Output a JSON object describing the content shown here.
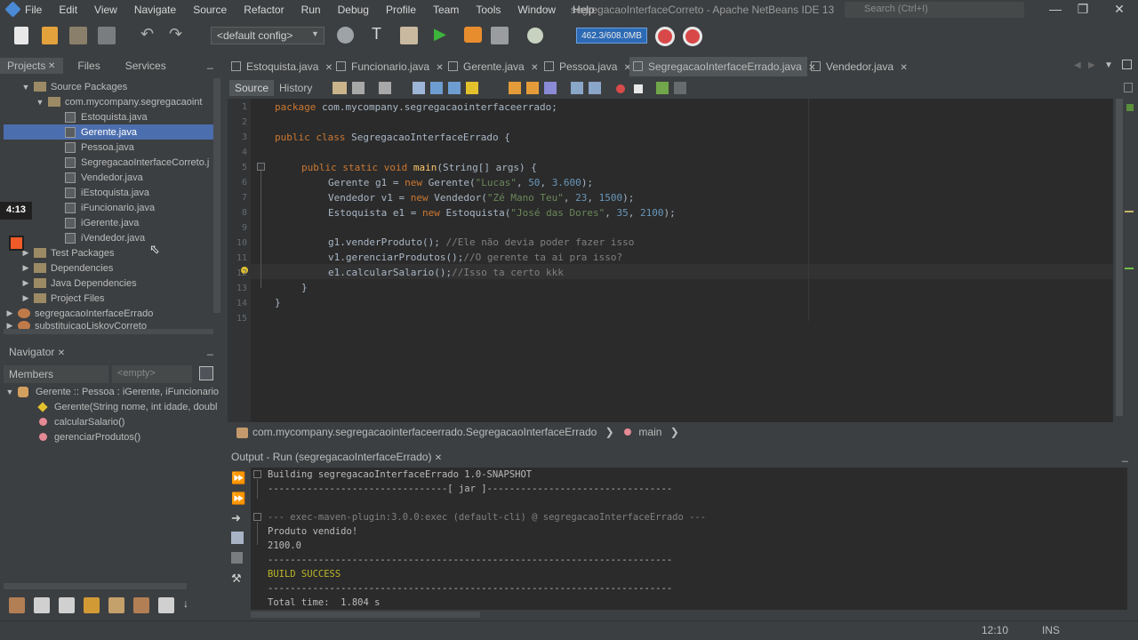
{
  "menu": [
    "File",
    "Edit",
    "View",
    "Navigate",
    "Source",
    "Refactor",
    "Run",
    "Debug",
    "Profile",
    "Team",
    "Tools",
    "Window",
    "Help"
  ],
  "window_title": "segregacaoInterfaceCorreto - Apache NetBeans IDE 13",
  "search_placeholder": "Search (Ctrl+I)",
  "toolbar": {
    "config": "<default config>",
    "memory": "462.3/608.0MB"
  },
  "projects_tabs": [
    "Projects",
    "Files",
    "Services"
  ],
  "tree": [
    {
      "label": "Source Packages",
      "level": 1,
      "kind": "folder",
      "open": true
    },
    {
      "label": "com.mycompany.segregacaoint",
      "level": 2,
      "kind": "folder",
      "open": true
    },
    {
      "label": "Estoquista.java",
      "level": 3,
      "kind": "file"
    },
    {
      "label": "Gerente.java",
      "level": 3,
      "kind": "file",
      "selected": true
    },
    {
      "label": "Pessoa.java",
      "level": 3,
      "kind": "file"
    },
    {
      "label": "SegregacaoInterfaceCorreto.j",
      "level": 3,
      "kind": "file"
    },
    {
      "label": "Vendedor.java",
      "level": 3,
      "kind": "file"
    },
    {
      "label": "iEstoquista.java",
      "level": 3,
      "kind": "file"
    },
    {
      "label": "iFuncionario.java",
      "level": 3,
      "kind": "file"
    },
    {
      "label": "iGerente.java",
      "level": 3,
      "kind": "file"
    },
    {
      "label": "iVendedor.java",
      "level": 3,
      "kind": "file"
    },
    {
      "label": "Test Packages",
      "level": 1,
      "kind": "folder"
    },
    {
      "label": "Dependencies",
      "level": 1,
      "kind": "folder"
    },
    {
      "label": "Java Dependencies",
      "level": 1,
      "kind": "folder"
    },
    {
      "label": "Project Files",
      "level": 1,
      "kind": "folder"
    },
    {
      "label": "segregacaoInterfaceErrado",
      "level": 0,
      "kind": "project"
    },
    {
      "label": "substituicaoLiskovCorreto",
      "level": 0,
      "kind": "project"
    }
  ],
  "video_time": "4:13",
  "navigator": {
    "title": "Navigator",
    "members": "Members",
    "empty": "<empty>",
    "class_row": "Gerente :: Pessoa : iGerente, iFuncionario",
    "items": [
      "Gerente(String nome, int idade, doubl",
      "calcularSalario()",
      "gerenciarProdutos()"
    ]
  },
  "editor_tabs": [
    "Estoquista.java",
    "Funcionario.java",
    "Gerente.java",
    "Pessoa.java",
    "SegregacaoInterfaceErrado.java",
    "Vendedor.java"
  ],
  "editor_toolbar": {
    "source": "Source",
    "history": "History"
  },
  "line_numbers": [
    "1",
    "2",
    "3",
    "4",
    "5",
    "6",
    "7",
    "8",
    "9",
    "10",
    "11",
    "12",
    "13",
    "14",
    "15"
  ],
  "code": {
    "l1_kw": "package",
    "l1_rest": " com.mycompany.segregacaointerfaceerrado;",
    "l3_kw": "public class",
    "l3_rest": " SegregacaoInterfaceErrado {",
    "l5_kw": "public static void",
    "l5_fn": "main",
    "l5_rest": "(String[] args) {",
    "l6_a": "Gerente g1 = ",
    "l6_new": "new",
    "l6_b": " Gerente(",
    "l6_s": "\"Lucas\"",
    "l6_c": ", ",
    "l6_n1": "50",
    "l6_d": ", ",
    "l6_n2": "3.600",
    "l6_e": ");",
    "l7_a": "Vendedor v1 = ",
    "l7_new": "new",
    "l7_b": " Vendedor(",
    "l7_s": "\"Zé Mano Teu\"",
    "l7_c": ", ",
    "l7_n1": "23",
    "l7_d": ", ",
    "l7_n2": "1500",
    "l7_e": ");",
    "l8_a": "Estoquista e1 = ",
    "l8_new": "new",
    "l8_b": " Estoquista(",
    "l8_s": "\"José das Dores\"",
    "l8_c": ", ",
    "l8_n1": "35",
    "l8_d": ", ",
    "l8_n2": "2100",
    "l8_e": ");",
    "l10_a": "g1.venderProduto(); ",
    "l10_cm": "//Ele não devia poder fazer isso",
    "l11_a": "v1.gerenciarProdutos();",
    "l11_cm": "//O gerente ta ai pra isso?",
    "l12_a": "e1.calcularSalario();",
    "l12_cm": "//Isso ta certo kkk",
    "l13": "}",
    "l14": "}"
  },
  "breadcrumb": {
    "path": "com.mycompany.segregacaointerfaceerrado.SegregacaoInterfaceErrado",
    "method": "main"
  },
  "output": {
    "title": "Output - Run (segregacaoInterfaceErrado)",
    "lines": [
      "Building segregacaoInterfaceErrado 1.0-SNAPSHOT",
      "--------------------------------[ jar ]---------------------------------",
      "",
      "--- exec-maven-plugin:3.0.0:exec (default-cli) @ segregacaoInterfaceErrado ---",
      "Produto vendido!",
      "2100.0",
      "------------------------------------------------------------------------",
      "BUILD SUCCESS",
      "------------------------------------------------------------------------",
      "Total time:  1.804 s"
    ]
  },
  "status": {
    "position": "12:10",
    "mode": "INS"
  }
}
